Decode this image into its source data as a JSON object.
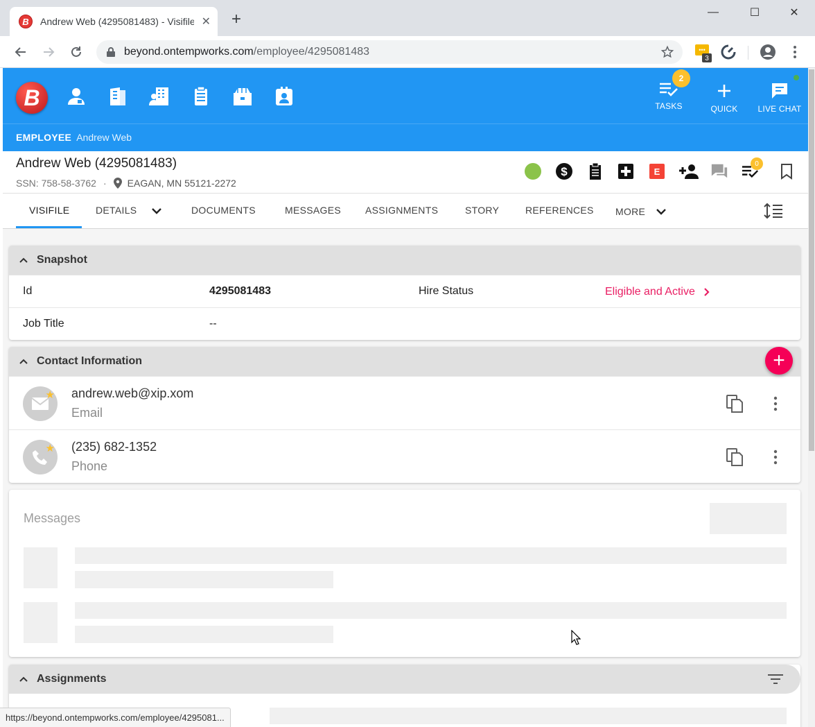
{
  "browser": {
    "tab_title": "Andrew Web (4295081483) - Visifile",
    "tab_close": "✕",
    "new_tab": "+",
    "url_host": "beyond.ontempworks.com",
    "url_path": "/employee/4295081483",
    "extension_badge": "3",
    "window_minimize": "—",
    "window_maximize": "☐",
    "window_close": "✕",
    "status_url": "https://beyond.ontempworks.com/employee/4295081..."
  },
  "appbar": {
    "logo_letter": "B",
    "nav_icons": [
      "employee-icon",
      "customer-icon",
      "company-icon",
      "order-icon",
      "job-icon",
      "contact-card-icon"
    ],
    "tasks": {
      "label": "TASKS",
      "count": "2"
    },
    "quick": {
      "label": "QUICK"
    },
    "live_chat": {
      "label": "LIVE CHAT"
    },
    "breadcrumb": {
      "type": "EMPLOYEE",
      "name": "Andrew Web"
    },
    "accent": "#2196f3"
  },
  "record": {
    "title": "Andrew Web (4295081483)",
    "ssn": "SSN: 758-58-3762",
    "separator": "·",
    "location": "EAGAN, MN 55121-2272",
    "e_badge": "E",
    "alerts_count": "0",
    "status_color": "#8bc34a"
  },
  "tabs": [
    {
      "label": "VISIFILE",
      "active": true
    },
    {
      "label": "DETAILS"
    },
    {
      "label": "DOCUMENTS"
    },
    {
      "label": "MESSAGES"
    },
    {
      "label": "ASSIGNMENTS"
    },
    {
      "label": "STORY"
    },
    {
      "label": "REFERENCES"
    },
    {
      "label": "MORE"
    }
  ],
  "snapshot": {
    "title": "Snapshot",
    "id_label": "Id",
    "id_value": "4295081483",
    "hire_status_label": "Hire Status",
    "hire_status_value": "Eligible and Active",
    "job_title_label": "Job Title",
    "job_title_value": "--"
  },
  "contact": {
    "title": "Contact Information",
    "add": "+",
    "items": [
      {
        "value": "andrew.web@xip.xom",
        "type": "Email",
        "icon": "email-icon"
      },
      {
        "value": "(235) 682-1352",
        "type": "Phone",
        "icon": "phone-icon"
      }
    ]
  },
  "messages": {
    "title": "Messages"
  },
  "assignments": {
    "title": "Assignments"
  },
  "colors": {
    "pink": "#e91e63",
    "fab": "#f50057",
    "badge": "#fbc02d",
    "e_badge": "#f44336"
  }
}
